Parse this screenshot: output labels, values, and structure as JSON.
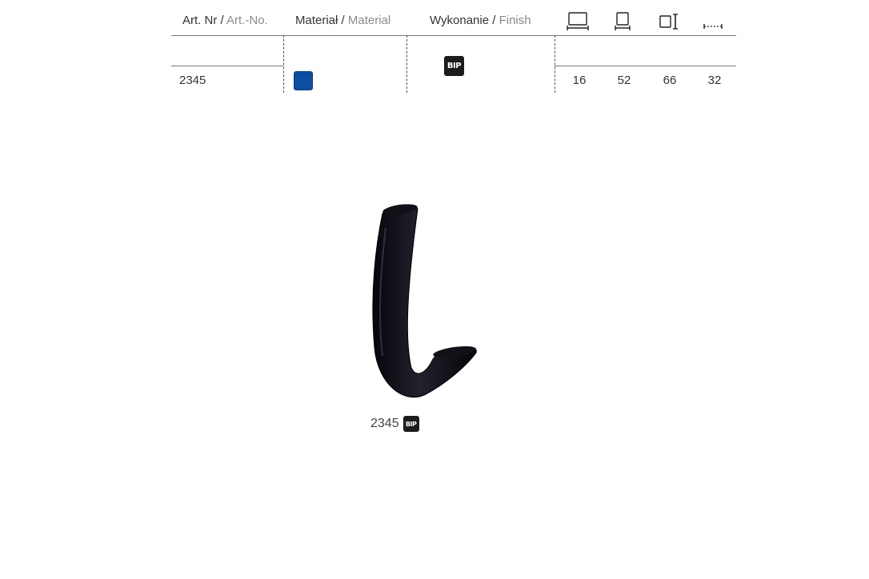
{
  "table": {
    "headers": {
      "art_nr": {
        "pl": "Art. Nr",
        "sep": " / ",
        "en": "Art.-No."
      },
      "material": {
        "pl": "Materiał",
        "sep": " / ",
        "en": "Material"
      },
      "finish": {
        "pl": "Wykonanie",
        "sep": " / ",
        "en": "Finish"
      }
    },
    "dimension_icons": [
      "width-icon",
      "base-width-icon",
      "height-icon",
      "hole-spacing-icon"
    ],
    "row": {
      "art_nr": "2345",
      "material_color": "#0b4ea2",
      "finish_code": "BIP",
      "dimensions": [
        "16",
        "52",
        "66",
        "32"
      ]
    }
  },
  "product": {
    "caption_number": "2345",
    "caption_finish": "BIP",
    "color": "#0d0d14"
  }
}
